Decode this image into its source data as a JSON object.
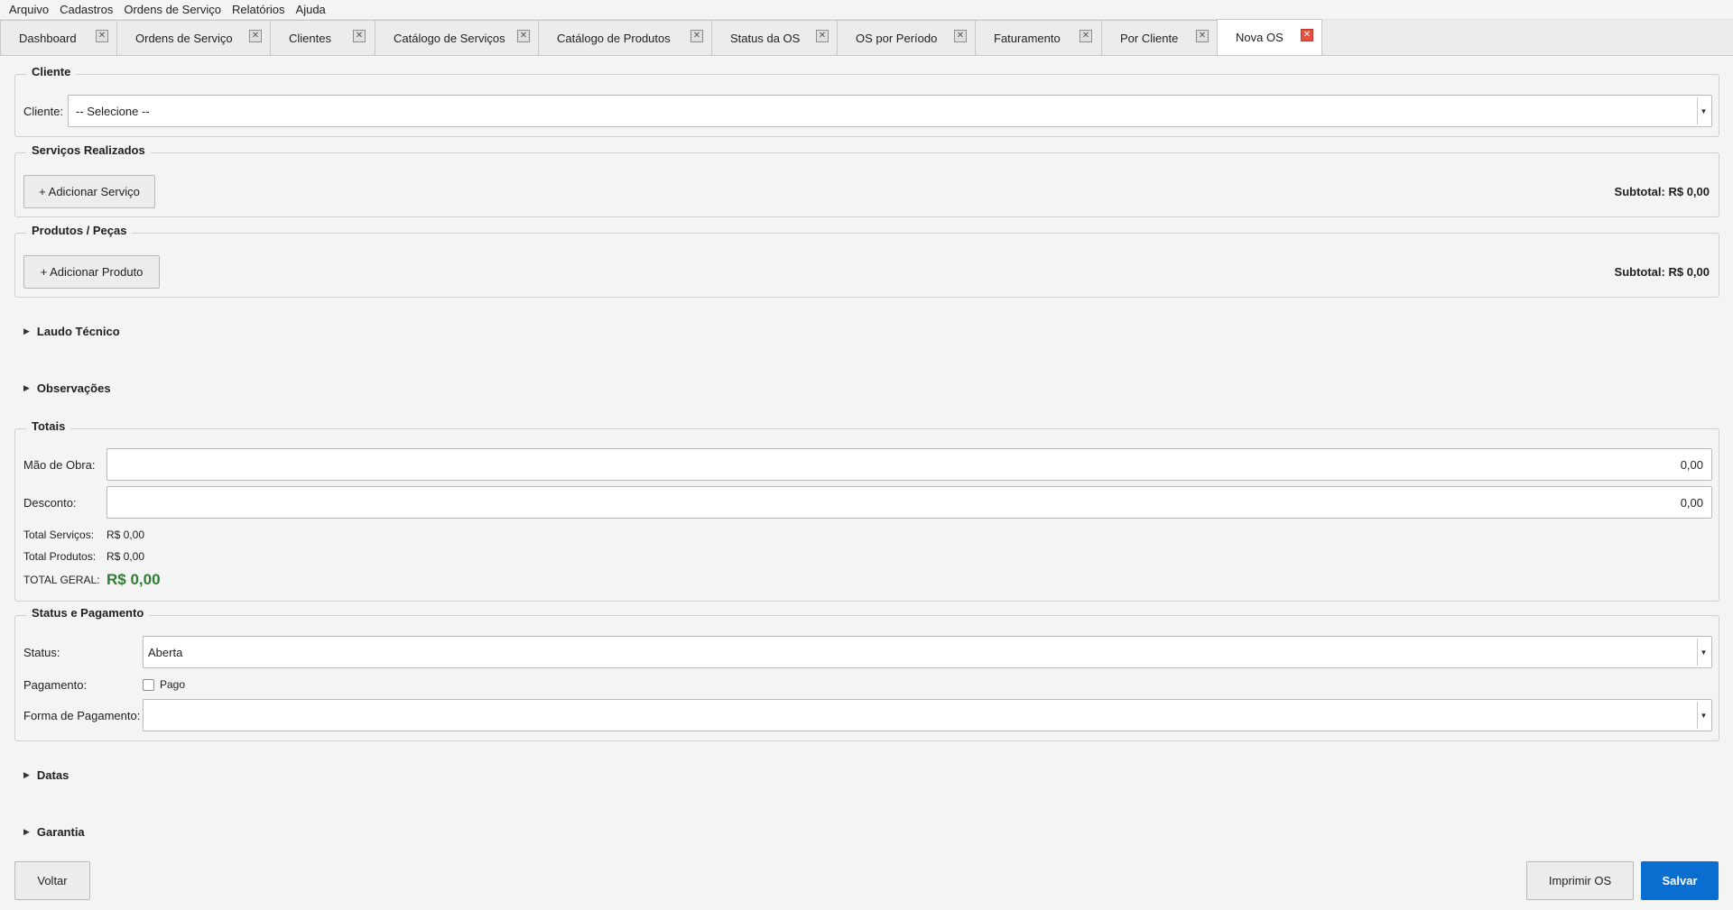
{
  "menu": [
    "Arquivo",
    "Cadastros",
    "Ordens de Serviço",
    "Relatórios",
    "Ajuda"
  ],
  "tabs": [
    {
      "label": "Dashboard"
    },
    {
      "label": "Ordens de Serviço"
    },
    {
      "label": "Clientes"
    },
    {
      "label": "Catálogo de Serviços"
    },
    {
      "label": "Catálogo de Produtos"
    },
    {
      "label": "Status da OS"
    },
    {
      "label": "OS por Período"
    },
    {
      "label": "Faturamento"
    },
    {
      "label": "Por Cliente"
    },
    {
      "label": "Nova OS"
    }
  ],
  "active_tab": "Nova OS",
  "cliente": {
    "legend": "Cliente",
    "label": "Cliente:",
    "selected": "-- Selecione --"
  },
  "servicos": {
    "legend": "Serviços Realizados",
    "add_button": "+ Adicionar Serviço",
    "subtotal": "Subtotal: R$ 0,00"
  },
  "produtos": {
    "legend": "Produtos / Peças",
    "add_button": "+ Adicionar Produto",
    "subtotal": "Subtotal: R$ 0,00"
  },
  "laudo": {
    "title": "Laudo Técnico"
  },
  "observacoes": {
    "title": "Observações"
  },
  "totais": {
    "legend": "Totais",
    "mao_de_obra_label": "Mão de Obra:",
    "mao_de_obra_value": "0,00",
    "desconto_label": "Desconto:",
    "desconto_value": "0,00",
    "total_servicos_label": "Total Serviços:",
    "total_servicos_value": "R$ 0,00",
    "total_produtos_label": "Total Produtos:",
    "total_produtos_value": "R$ 0,00",
    "total_geral_label": "TOTAL GERAL:",
    "total_geral_value": "R$ 0,00",
    "total_geral_color": "#2e7d32"
  },
  "status_pagamento": {
    "legend": "Status e Pagamento",
    "status_label": "Status:",
    "status_value": "Aberta",
    "pagamento_label": "Pagamento:",
    "pago_label": "Pago",
    "pago_checked": false,
    "forma_label": "Forma de Pagamento:",
    "forma_value": ""
  },
  "datas": {
    "title": "Datas"
  },
  "garantia": {
    "title": "Garantia"
  },
  "footer": {
    "voltar": "Voltar",
    "imprimir": "Imprimir OS",
    "salvar": "Salvar"
  },
  "colors": {
    "primary": "#0a6ed1",
    "active_tab_close": "#e5503f"
  }
}
